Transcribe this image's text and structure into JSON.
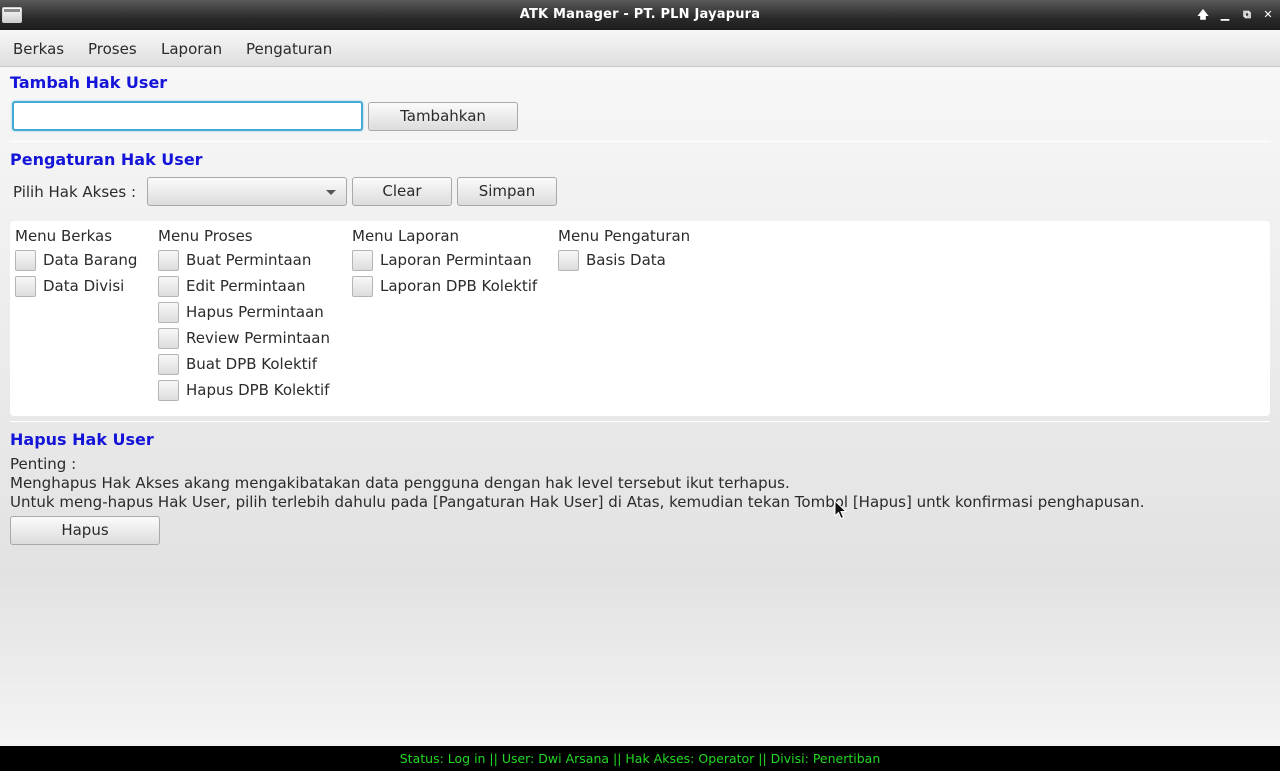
{
  "window": {
    "title": "ATK Manager - PT. PLN Jayapura"
  },
  "menubar": {
    "items": [
      "Berkas",
      "Proses",
      "Laporan",
      "Pengaturan"
    ]
  },
  "tambah": {
    "title": "Tambah Hak User",
    "input_value": "",
    "button": "Tambahkan"
  },
  "pengaturan": {
    "title": "Pengaturan Hak User",
    "pilih_label": "Pilih Hak Akses :",
    "selected_value": "",
    "clear_button": "Clear",
    "simpan_button": "Simpan",
    "columns": [
      {
        "header": "Menu Berkas",
        "items": [
          {
            "label": "Data Barang",
            "checked": false
          },
          {
            "label": "Data Divisi",
            "checked": false
          }
        ]
      },
      {
        "header": "Menu Proses",
        "items": [
          {
            "label": "Buat Permintaan",
            "checked": false
          },
          {
            "label": "Edit Permintaan",
            "checked": false
          },
          {
            "label": "Hapus Permintaan",
            "checked": false
          },
          {
            "label": "Review Permintaan",
            "checked": false
          },
          {
            "label": "Buat DPB Kolektif",
            "checked": false
          },
          {
            "label": "Hapus DPB Kolektif",
            "checked": false
          }
        ]
      },
      {
        "header": "Menu Laporan",
        "items": [
          {
            "label": "Laporan Permintaan",
            "checked": false
          },
          {
            "label": "Laporan DPB Kolektif",
            "checked": false
          }
        ]
      },
      {
        "header": "Menu Pengaturan",
        "items": [
          {
            "label": "Basis Data",
            "checked": false
          }
        ]
      }
    ]
  },
  "hapus": {
    "title": "Hapus Hak User",
    "penting": "Penting :",
    "line1": "Menghapus Hak Akses akang mengakibatakan data pengguna dengan hak level tersebut ikut terhapus.",
    "line2": "Untuk meng-hapus Hak User, pilih terlebih dahulu pada [Pangaturan Hak User] di Atas, kemudian tekan Tombol [Hapus] untk konfirmasi penghapusan.",
    "button": "Hapus"
  },
  "status": {
    "text": "Status: Log in  ||  User: Dwi Arsana  ||  Hak Akses: Operator  ||  Divisi: Penertiban",
    "color": "#22d822"
  },
  "icons": {
    "app": "window-icon",
    "titlebar_buttons": [
      "up-arrow-icon",
      "minimize-icon",
      "restore-icon",
      "close-icon"
    ]
  }
}
